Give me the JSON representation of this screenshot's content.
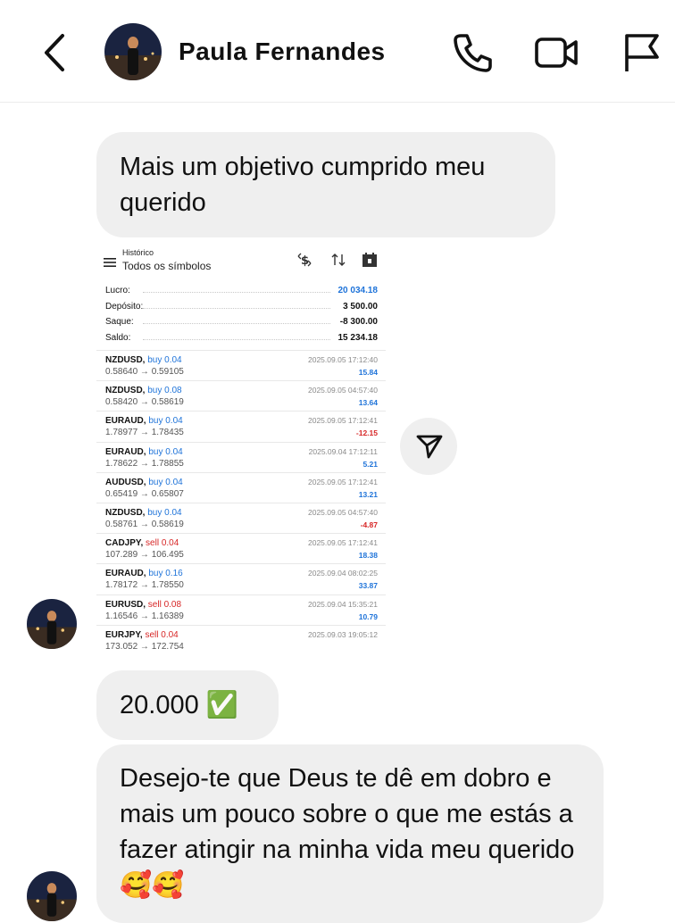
{
  "header": {
    "contact_name": "Paula Fernandes"
  },
  "messages": {
    "m1": "Mais um objetivo cumprido meu querido",
    "m2": "20.000 ✅",
    "m3": "Desejo-te que Deus te dê em dobro e mais um pouco sobre o que me estás a fazer atingir na minha vida meu querido 🥰🥰"
  },
  "screenshot": {
    "title_small": "Histórico",
    "title": "Todos os símbolos",
    "summary": [
      {
        "label": "Lucro:",
        "value": "20 034.18",
        "color": "#1e73d9"
      },
      {
        "label": "Depósito:",
        "value": "3 500.00",
        "color": "#111111"
      },
      {
        "label": "Saque:",
        "value": "-8 300.00",
        "color": "#111111"
      },
      {
        "label": "Saldo:",
        "value": "15 234.18",
        "color": "#111111"
      }
    ],
    "trades": [
      {
        "symbol": "NZDUSD,",
        "side": "buy 0.04",
        "type": "buy",
        "prices": "0.58640 → 0.59105",
        "date": "2025.09.05 17:12:40",
        "pl": "15.84",
        "sign": "pos"
      },
      {
        "symbol": "NZDUSD,",
        "side": "buy 0.08",
        "type": "buy",
        "prices": "0.58420 → 0.58619",
        "date": "2025.09.05 04:57:40",
        "pl": "13.64",
        "sign": "pos"
      },
      {
        "symbol": "EURAUD,",
        "side": "buy 0.04",
        "type": "buy",
        "prices": "1.78977 → 1.78435",
        "date": "2025.09.05 17:12:41",
        "pl": "-12.15",
        "sign": "neg"
      },
      {
        "symbol": "EURAUD,",
        "side": "buy 0.04",
        "type": "buy",
        "prices": "1.78622 → 1.78855",
        "date": "2025.09.04 17:12:11",
        "pl": "5.21",
        "sign": "pos"
      },
      {
        "symbol": "AUDUSD,",
        "side": "buy 0.04",
        "type": "buy",
        "prices": "0.65419 → 0.65807",
        "date": "2025.09.05 17:12:41",
        "pl": "13.21",
        "sign": "pos"
      },
      {
        "symbol": "NZDUSD,",
        "side": "buy 0.04",
        "type": "buy",
        "prices": "0.58761 → 0.58619",
        "date": "2025.09.05 04:57:40",
        "pl": "-4.87",
        "sign": "neg"
      },
      {
        "symbol": "CADJPY,",
        "side": "sell 0.04",
        "type": "sell",
        "prices": "107.289 → 106.495",
        "date": "2025.09.05 17:12:41",
        "pl": "18.38",
        "sign": "pos"
      },
      {
        "symbol": "EURAUD,",
        "side": "buy 0.16",
        "type": "buy",
        "prices": "1.78172 → 1.78550",
        "date": "2025.09.04 08:02:25",
        "pl": "33.87",
        "sign": "pos"
      },
      {
        "symbol": "EURUSD,",
        "side": "sell 0.08",
        "type": "sell",
        "prices": "1.16546 → 1.16389",
        "date": "2025.09.04 15:35:21",
        "pl": "10.79",
        "sign": "pos"
      },
      {
        "symbol": "EURJPY,",
        "side": "sell 0.04",
        "type": "sell",
        "prices": "173.052 → 172.754",
        "date": "2025.09.03 19:05:12",
        "pl": "",
        "sign": "pos"
      }
    ]
  },
  "icons": {
    "back": "chevron-left-icon",
    "call": "phone-icon",
    "video": "video-camera-icon",
    "report": "flag-icon",
    "share": "send-icon"
  }
}
